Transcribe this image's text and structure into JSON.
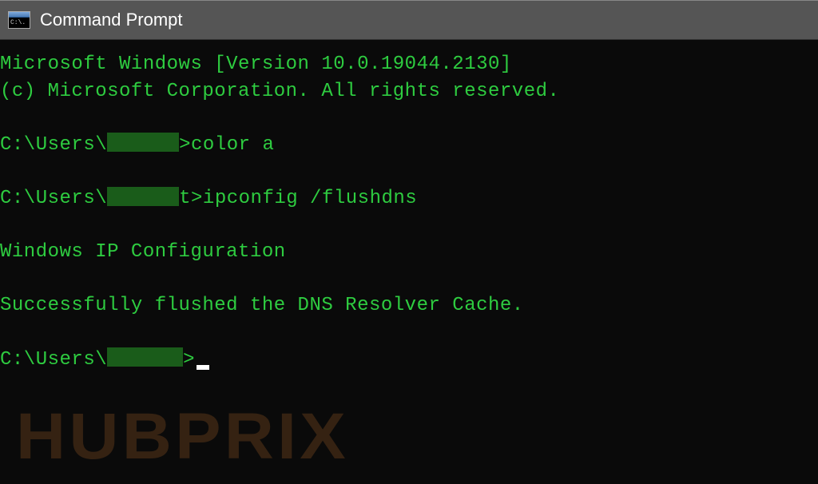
{
  "titlebar": {
    "icon_text": "C:\\.",
    "title": "Command Prompt"
  },
  "terminal": {
    "line1": "Microsoft Windows [Version 10.0.19044.2130]",
    "line2": "(c) Microsoft Corporation. All rights reserved.",
    "prompt1_prefix": "C:\\Users\\",
    "prompt1_suffix": ">color a",
    "prompt2_prefix": "C:\\Users\\",
    "prompt2_mid": "t",
    "prompt2_suffix": ">ipconfig /flushdns",
    "output1": "Windows IP Configuration",
    "output2": "Successfully flushed the DNS Resolver Cache.",
    "prompt3_prefix": "C:\\Users\\",
    "prompt3_suffix": ">"
  },
  "watermark": "HUBPRIX"
}
